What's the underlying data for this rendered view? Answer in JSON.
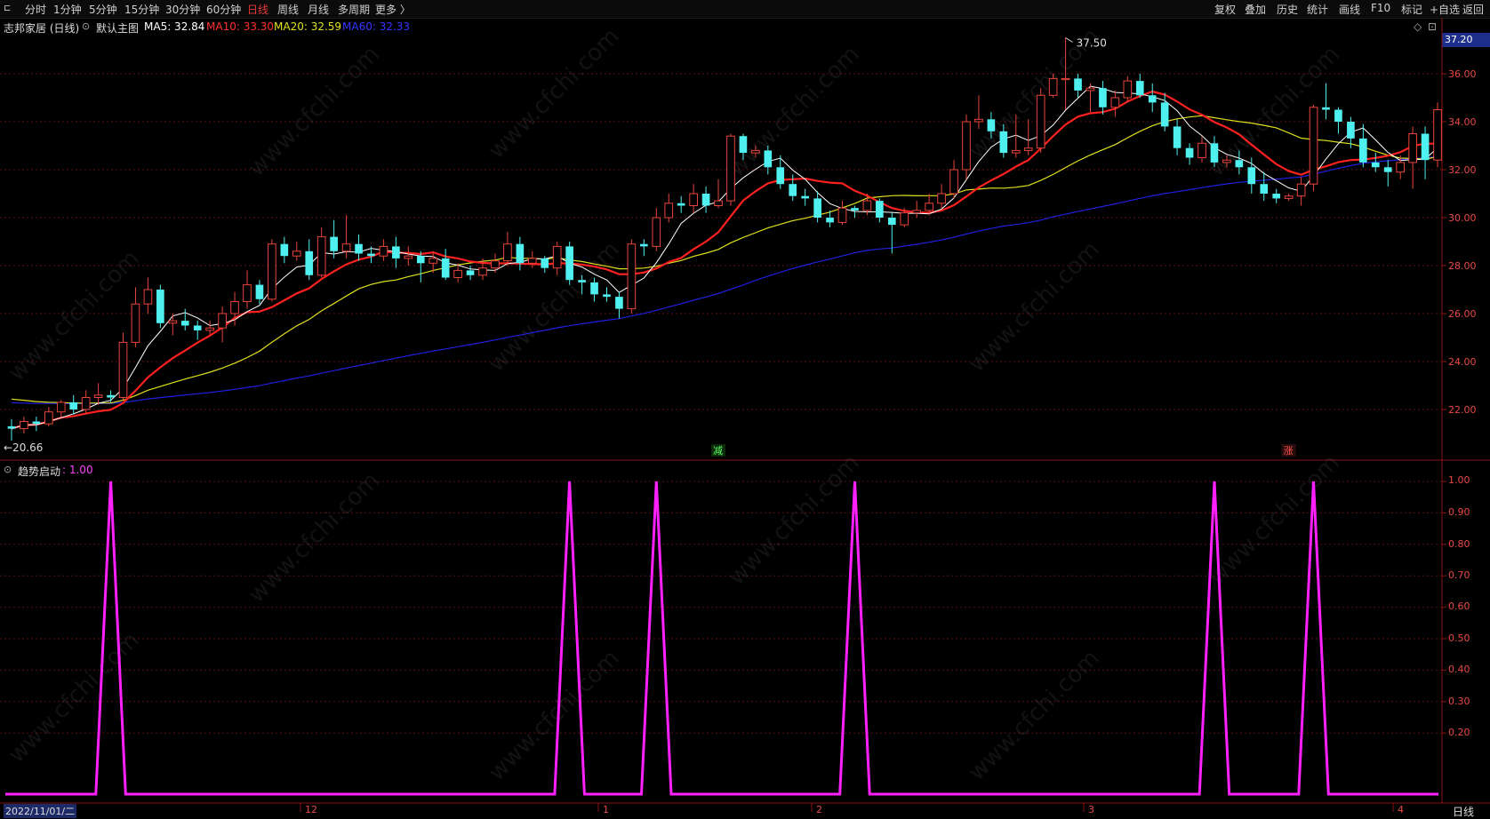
{
  "toolbar": {
    "left_items": [
      "分时",
      "1分钟",
      "5分钟",
      "15分钟",
      "30分钟",
      "60分钟",
      "日线",
      "周线",
      "月线",
      "多周期",
      "更多 〉"
    ],
    "active_item": "日线",
    "right_items": [
      "复权",
      "叠加",
      "历史",
      "统计",
      "画线",
      "F10",
      "标记",
      "+自选",
      "返回"
    ]
  },
  "info": {
    "stock_name": "志邦家居 (日线)",
    "main_chart_label": "默认主图",
    "ma5": "MA5: 32.84",
    "ma10": "MA10: 33.30",
    "ma20": "MA20: 32.59",
    "ma60": "MA60: 32.33"
  },
  "indicator": {
    "name": "趋势启动",
    "value": ": 1.00"
  },
  "price_axis": [
    "36.00",
    "34.00",
    "32.00",
    "30.00",
    "28.00",
    "26.00",
    "24.00",
    "22.00"
  ],
  "indicator_axis": [
    "1.00",
    "0.90",
    "0.80",
    "0.70",
    "0.60",
    "0.50",
    "0.40",
    "0.30",
    "0.20"
  ],
  "current_price": "37.20",
  "annotations": {
    "high": "37.50",
    "low": "20.66",
    "marker_down": "减",
    "marker_up": "涨"
  },
  "x_axis": {
    "start_date": "2022/11/01/二",
    "ticks": [
      "12",
      "1",
      "2",
      "3",
      "4"
    ]
  },
  "period_button": "日线",
  "watermark": "www.cfchi.com",
  "colors": {
    "up": "#e8443a",
    "down": "#4ff0f0",
    "ma5": "#ffffff",
    "ma10": "#ff2020",
    "ma20": "#e0e020",
    "ma60": "#2020e0",
    "indicator": "#ff20ff",
    "grid": "#5a1010"
  },
  "chart_data": {
    "type": "candlestick",
    "price_range": [
      20,
      37.5
    ],
    "candles": [
      [
        21.3,
        21.2,
        20.7,
        21.6
      ],
      [
        21.2,
        21.5,
        21.0,
        21.7
      ],
      [
        21.5,
        21.4,
        21.1,
        21.7
      ],
      [
        21.4,
        21.9,
        21.3,
        22.1
      ],
      [
        21.9,
        22.3,
        21.7,
        22.4
      ],
      [
        22.3,
        22.0,
        21.8,
        22.6
      ],
      [
        22.0,
        22.5,
        21.8,
        22.8
      ],
      [
        22.5,
        22.6,
        22.2,
        23.1
      ],
      [
        22.6,
        22.5,
        22.3,
        22.8
      ],
      [
        22.5,
        24.8,
        22.4,
        25.2
      ],
      [
        24.8,
        26.4,
        24.6,
        27.1
      ],
      [
        26.4,
        27.0,
        26.0,
        27.5
      ],
      [
        27.0,
        25.6,
        25.4,
        27.2
      ],
      [
        25.6,
        25.7,
        25.1,
        26.0
      ],
      [
        25.7,
        25.5,
        25.3,
        26.2
      ],
      [
        25.5,
        25.3,
        24.9,
        25.7
      ],
      [
        25.3,
        25.4,
        25.1,
        25.7
      ],
      [
        25.4,
        26.0,
        24.8,
        26.3
      ],
      [
        26.0,
        26.5,
        25.5,
        26.9
      ],
      [
        26.5,
        27.2,
        26.2,
        27.8
      ],
      [
        27.2,
        26.6,
        26.4,
        27.4
      ],
      [
        26.6,
        28.9,
        26.5,
        29.1
      ],
      [
        28.9,
        28.4,
        28.1,
        29.2
      ],
      [
        28.4,
        28.6,
        28.2,
        29.0
      ],
      [
        28.6,
        27.6,
        27.4,
        29.1
      ],
      [
        27.6,
        29.2,
        27.5,
        29.6
      ],
      [
        29.2,
        28.6,
        28.3,
        29.9
      ],
      [
        28.6,
        28.9,
        28.3,
        30.1
      ],
      [
        28.9,
        28.5,
        28.2,
        29.3
      ],
      [
        28.5,
        28.4,
        28.1,
        28.8
      ],
      [
        28.4,
        28.8,
        28.2,
        29.1
      ],
      [
        28.8,
        28.3,
        27.9,
        29.2
      ],
      [
        28.3,
        28.4,
        28.0,
        28.8
      ],
      [
        28.4,
        28.1,
        27.3,
        28.6
      ],
      [
        28.1,
        28.3,
        27.7,
        28.6
      ],
      [
        28.3,
        27.5,
        27.4,
        28.7
      ],
      [
        27.5,
        27.8,
        27.3,
        28.1
      ],
      [
        27.8,
        27.6,
        27.4,
        28.0
      ],
      [
        27.6,
        27.9,
        27.4,
        28.3
      ],
      [
        27.9,
        28.2,
        27.7,
        28.5
      ],
      [
        28.2,
        28.9,
        28.0,
        29.4
      ],
      [
        28.9,
        28.1,
        27.8,
        29.2
      ],
      [
        28.1,
        28.3,
        27.9,
        28.6
      ],
      [
        28.3,
        27.9,
        27.7,
        28.4
      ],
      [
        27.9,
        28.8,
        27.6,
        29.0
      ],
      [
        28.8,
        27.4,
        27.2,
        29.0
      ],
      [
        27.4,
        27.3,
        26.8,
        27.6
      ],
      [
        27.3,
        26.8,
        26.5,
        27.5
      ],
      [
        26.8,
        26.7,
        26.5,
        27.1
      ],
      [
        26.7,
        26.2,
        25.8,
        26.9
      ],
      [
        26.2,
        28.9,
        26.0,
        29.1
      ],
      [
        28.9,
        28.8,
        28.4,
        29.1
      ],
      [
        28.8,
        30.0,
        28.6,
        30.4
      ],
      [
        30.0,
        30.6,
        29.8,
        31.0
      ],
      [
        30.6,
        30.5,
        30.2,
        30.9
      ],
      [
        30.5,
        31.0,
        30.2,
        31.4
      ],
      [
        31.0,
        30.5,
        30.2,
        31.3
      ],
      [
        30.5,
        30.7,
        30.4,
        31.6
      ],
      [
        30.7,
        33.4,
        30.5,
        33.5
      ],
      [
        33.4,
        32.7,
        32.4,
        33.5
      ],
      [
        32.7,
        32.8,
        32.5,
        33.0
      ],
      [
        32.8,
        32.1,
        31.8,
        33.0
      ],
      [
        32.1,
        31.4,
        31.2,
        32.6
      ],
      [
        31.4,
        30.9,
        30.7,
        31.8
      ],
      [
        30.9,
        30.8,
        30.5,
        31.2
      ],
      [
        30.8,
        30.0,
        29.8,
        31.1
      ],
      [
        30.0,
        29.8,
        29.6,
        30.3
      ],
      [
        29.8,
        30.4,
        29.7,
        30.7
      ],
      [
        30.4,
        30.3,
        30.0,
        30.5
      ],
      [
        30.3,
        30.7,
        30.1,
        31.0
      ],
      [
        30.7,
        30.0,
        29.8,
        30.8
      ],
      [
        30.0,
        29.7,
        28.5,
        30.2
      ],
      [
        29.7,
        30.2,
        29.6,
        30.4
      ],
      [
        30.2,
        30.3,
        30.0,
        30.7
      ],
      [
        30.3,
        30.6,
        30.1,
        31.0
      ],
      [
        30.6,
        31.0,
        30.4,
        31.4
      ],
      [
        31.0,
        32.0,
        30.8,
        32.4
      ],
      [
        32.0,
        34.0,
        31.6,
        34.3
      ],
      [
        34.0,
        34.1,
        33.7,
        35.1
      ],
      [
        34.1,
        33.6,
        33.3,
        34.4
      ],
      [
        33.6,
        32.7,
        32.5,
        33.9
      ],
      [
        32.7,
        32.8,
        32.5,
        34.3
      ],
      [
        32.8,
        32.9,
        32.6,
        34.1
      ],
      [
        32.9,
        35.1,
        32.7,
        35.4
      ],
      [
        35.1,
        35.8,
        35.0,
        36.0
      ],
      [
        35.8,
        35.8,
        34.5,
        37.5
      ],
      [
        35.8,
        35.3,
        35.0,
        36.0
      ],
      [
        35.3,
        35.4,
        34.4,
        35.6
      ],
      [
        35.4,
        34.6,
        34.3,
        35.7
      ],
      [
        34.6,
        35.0,
        34.2,
        35.3
      ],
      [
        35.0,
        35.7,
        34.8,
        35.9
      ],
      [
        35.7,
        35.1,
        35.0,
        36.0
      ],
      [
        35.1,
        34.8,
        34.4,
        35.6
      ],
      [
        34.8,
        33.8,
        33.6,
        35.2
      ],
      [
        33.8,
        32.9,
        32.6,
        34.1
      ],
      [
        32.9,
        32.5,
        32.2,
        33.1
      ],
      [
        32.5,
        33.1,
        32.3,
        33.4
      ],
      [
        33.1,
        32.3,
        32.1,
        33.4
      ],
      [
        32.3,
        32.4,
        32.1,
        32.6
      ],
      [
        32.4,
        32.1,
        31.8,
        32.8
      ],
      [
        32.1,
        31.4,
        31.0,
        32.5
      ],
      [
        31.4,
        31.0,
        30.7,
        31.9
      ],
      [
        31.0,
        30.8,
        30.6,
        31.2
      ],
      [
        30.8,
        30.9,
        30.7,
        31.0
      ],
      [
        30.9,
        31.4,
        30.5,
        31.7
      ],
      [
        31.4,
        34.6,
        31.1,
        34.7
      ],
      [
        34.6,
        34.5,
        34.1,
        35.6
      ],
      [
        34.5,
        34.0,
        33.5,
        34.6
      ],
      [
        34.0,
        33.3,
        32.9,
        34.2
      ],
      [
        33.3,
        32.3,
        32.1,
        33.9
      ],
      [
        32.3,
        32.1,
        31.9,
        32.7
      ],
      [
        32.1,
        31.9,
        31.3,
        32.4
      ],
      [
        31.9,
        32.3,
        31.6,
        32.6
      ],
      [
        32.3,
        33.5,
        31.2,
        33.8
      ],
      [
        33.5,
        32.4,
        31.6,
        33.8
      ],
      [
        32.4,
        34.5,
        32.1,
        34.8
      ]
    ],
    "trend_signal_bars": [
      8,
      45,
      52,
      68,
      97,
      105
    ]
  }
}
